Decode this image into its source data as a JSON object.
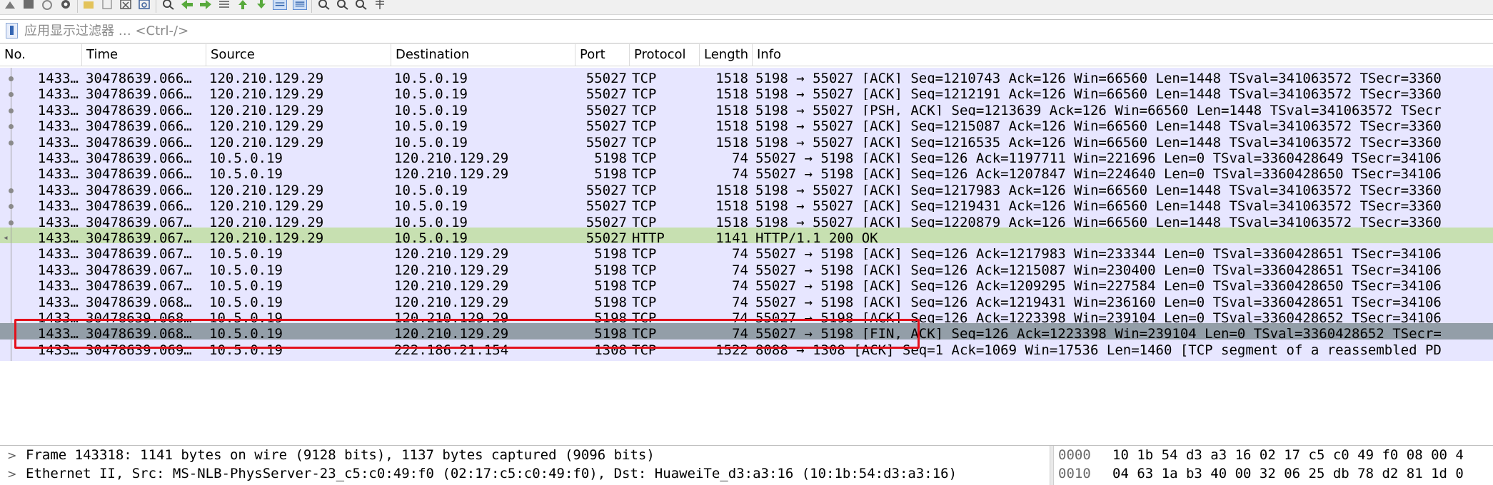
{
  "filter": {
    "placeholder": "应用显示过滤器 … <Ctrl-/>"
  },
  "columns": [
    "No.",
    "Time",
    "Source",
    "Destination",
    "Port",
    "Protocol",
    "Length",
    "Info"
  ],
  "packets": [
    {
      "no": "1433…",
      "time": "30478639.066…",
      "src": "120.210.129.29",
      "dst": "10.5.0.19",
      "port": "55027",
      "proto": "TCP",
      "len": "1518",
      "info": "5198 → 55027 [ACK] Seq=1210743 Ack=126 Win=66560 Len=1448 TSval=341063572 TSecr=3360"
    },
    {
      "no": "1433…",
      "time": "30478639.066…",
      "src": "120.210.129.29",
      "dst": "10.5.0.19",
      "port": "55027",
      "proto": "TCP",
      "len": "1518",
      "info": "5198 → 55027 [ACK] Seq=1212191 Ack=126 Win=66560 Len=1448 TSval=341063572 TSecr=3360"
    },
    {
      "no": "1433…",
      "time": "30478639.066…",
      "src": "120.210.129.29",
      "dst": "10.5.0.19",
      "port": "55027",
      "proto": "TCP",
      "len": "1518",
      "info": "5198 → 55027 [PSH, ACK] Seq=1213639 Ack=126 Win=66560 Len=1448 TSval=341063572 TSecr"
    },
    {
      "no": "1433…",
      "time": "30478639.066…",
      "src": "120.210.129.29",
      "dst": "10.5.0.19",
      "port": "55027",
      "proto": "TCP",
      "len": "1518",
      "info": "5198 → 55027 [ACK] Seq=1215087 Ack=126 Win=66560 Len=1448 TSval=341063572 TSecr=3360"
    },
    {
      "no": "1433…",
      "time": "30478639.066…",
      "src": "120.210.129.29",
      "dst": "10.5.0.19",
      "port": "55027",
      "proto": "TCP",
      "len": "1518",
      "info": "5198 → 55027 [ACK] Seq=1216535 Ack=126 Win=66560 Len=1448 TSval=341063572 TSecr=3360"
    },
    {
      "no": "1433…",
      "time": "30478639.066…",
      "src": "10.5.0.19",
      "dst": "120.210.129.29",
      "port": "5198",
      "proto": "TCP",
      "len": "74",
      "info": "55027 → 5198 [ACK] Seq=126 Ack=1197711 Win=221696 Len=0 TSval=3360428649 TSecr=34106"
    },
    {
      "no": "1433…",
      "time": "30478639.066…",
      "src": "10.5.0.19",
      "dst": "120.210.129.29",
      "port": "5198",
      "proto": "TCP",
      "len": "74",
      "info": "55027 → 5198 [ACK] Seq=126 Ack=1207847 Win=224640 Len=0 TSval=3360428650 TSecr=34106"
    },
    {
      "no": "1433…",
      "time": "30478639.066…",
      "src": "120.210.129.29",
      "dst": "10.5.0.19",
      "port": "55027",
      "proto": "TCP",
      "len": "1518",
      "info": "5198 → 55027 [ACK] Seq=1217983 Ack=126 Win=66560 Len=1448 TSval=341063572 TSecr=3360"
    },
    {
      "no": "1433…",
      "time": "30478639.066…",
      "src": "120.210.129.29",
      "dst": "10.5.0.19",
      "port": "55027",
      "proto": "TCP",
      "len": "1518",
      "info": "5198 → 55027 [ACK] Seq=1219431 Ack=126 Win=66560 Len=1448 TSval=341063572 TSecr=3360"
    },
    {
      "no": "1433…",
      "time": "30478639.067…",
      "src": "120.210.129.29",
      "dst": "10.5.0.19",
      "port": "55027",
      "proto": "TCP",
      "len": "1518",
      "info": "5198 → 55027 [ACK] Seq=1220879 Ack=126 Win=66560 Len=1448 TSval=341063572 TSecr=3360"
    },
    {
      "no": "1433…",
      "time": "30478639.067…",
      "src": "120.210.129.29",
      "dst": "10.5.0.19",
      "port": "55027",
      "proto": "HTTP",
      "len": "1141",
      "info": "HTTP/1.1 200 OK"
    },
    {
      "no": "1433…",
      "time": "30478639.067…",
      "src": "10.5.0.19",
      "dst": "120.210.129.29",
      "port": "5198",
      "proto": "TCP",
      "len": "74",
      "info": "55027 → 5198 [ACK] Seq=126 Ack=1217983 Win=233344 Len=0 TSval=3360428651 TSecr=34106"
    },
    {
      "no": "1433…",
      "time": "30478639.067…",
      "src": "10.5.0.19",
      "dst": "120.210.129.29",
      "port": "5198",
      "proto": "TCP",
      "len": "74",
      "info": "55027 → 5198 [ACK] Seq=126 Ack=1215087 Win=230400 Len=0 TSval=3360428651 TSecr=34106"
    },
    {
      "no": "1433…",
      "time": "30478639.067…",
      "src": "10.5.0.19",
      "dst": "120.210.129.29",
      "port": "5198",
      "proto": "TCP",
      "len": "74",
      "info": "55027 → 5198 [ACK] Seq=126 Ack=1209295 Win=227584 Len=0 TSval=3360428650 TSecr=34106"
    },
    {
      "no": "1433…",
      "time": "30478639.068…",
      "src": "10.5.0.19",
      "dst": "120.210.129.29",
      "port": "5198",
      "proto": "TCP",
      "len": "74",
      "info": "55027 → 5198 [ACK] Seq=126 Ack=1219431 Win=236160 Len=0 TSval=3360428651 TSecr=34106"
    },
    {
      "no": "1433…",
      "time": "30478639.068…",
      "src": "10.5.0.19",
      "dst": "120.210.129.29",
      "port": "5198",
      "proto": "TCP",
      "len": "74",
      "info": "55027 → 5198 [ACK] Seq=126 Ack=1223398 Win=239104 Len=0 TSval=3360428652 TSecr=34106"
    },
    {
      "no": "1433…",
      "time": "30478639.068…",
      "src": "10.5.0.19",
      "dst": "120.210.129.29",
      "port": "5198",
      "proto": "TCP",
      "len": "74",
      "info": "55027 → 5198 [FIN, ACK] Seq=126 Ack=1223398 Win=239104 Len=0 TSval=3360428652 TSecr="
    },
    {
      "no": "1433…",
      "time": "30478639.069…",
      "src": "10.5.0.19",
      "dst": "222.186.21.154",
      "port": "1308",
      "proto": "TCP",
      "len": "1522",
      "info": "8088 → 1308 [ACK] Seq=1 Ack=1069 Win=17536 Len=1460 [TCP segment of a reassembled PD"
    }
  ],
  "details": [
    "Frame 143318: 1141 bytes on wire (9128 bits), 1137 bytes captured (9096 bits)",
    "Ethernet II, Src: MS-NLB-PhysServer-23_c5:c0:49:f0 (02:17:c5:c0:49:f0), Dst: HuaweiTe_d3:a3:16 (10:1b:54:d3:a3:16)"
  ],
  "hex": [
    {
      "offset": "0000",
      "bytes": "10 1b 54 d3 a3 16 02 17  c5 c0 49 f0 08 00 4"
    },
    {
      "offset": "0010",
      "bytes": "04 63 1a b3 40 00 32 06  25 db 78 d2 81 1d 0"
    }
  ],
  "colors": {
    "tcp_row": "#e7e6ff",
    "http_row": "#c7e0b1",
    "selected_row": "#939ea8",
    "annotation": "#e4101b"
  }
}
